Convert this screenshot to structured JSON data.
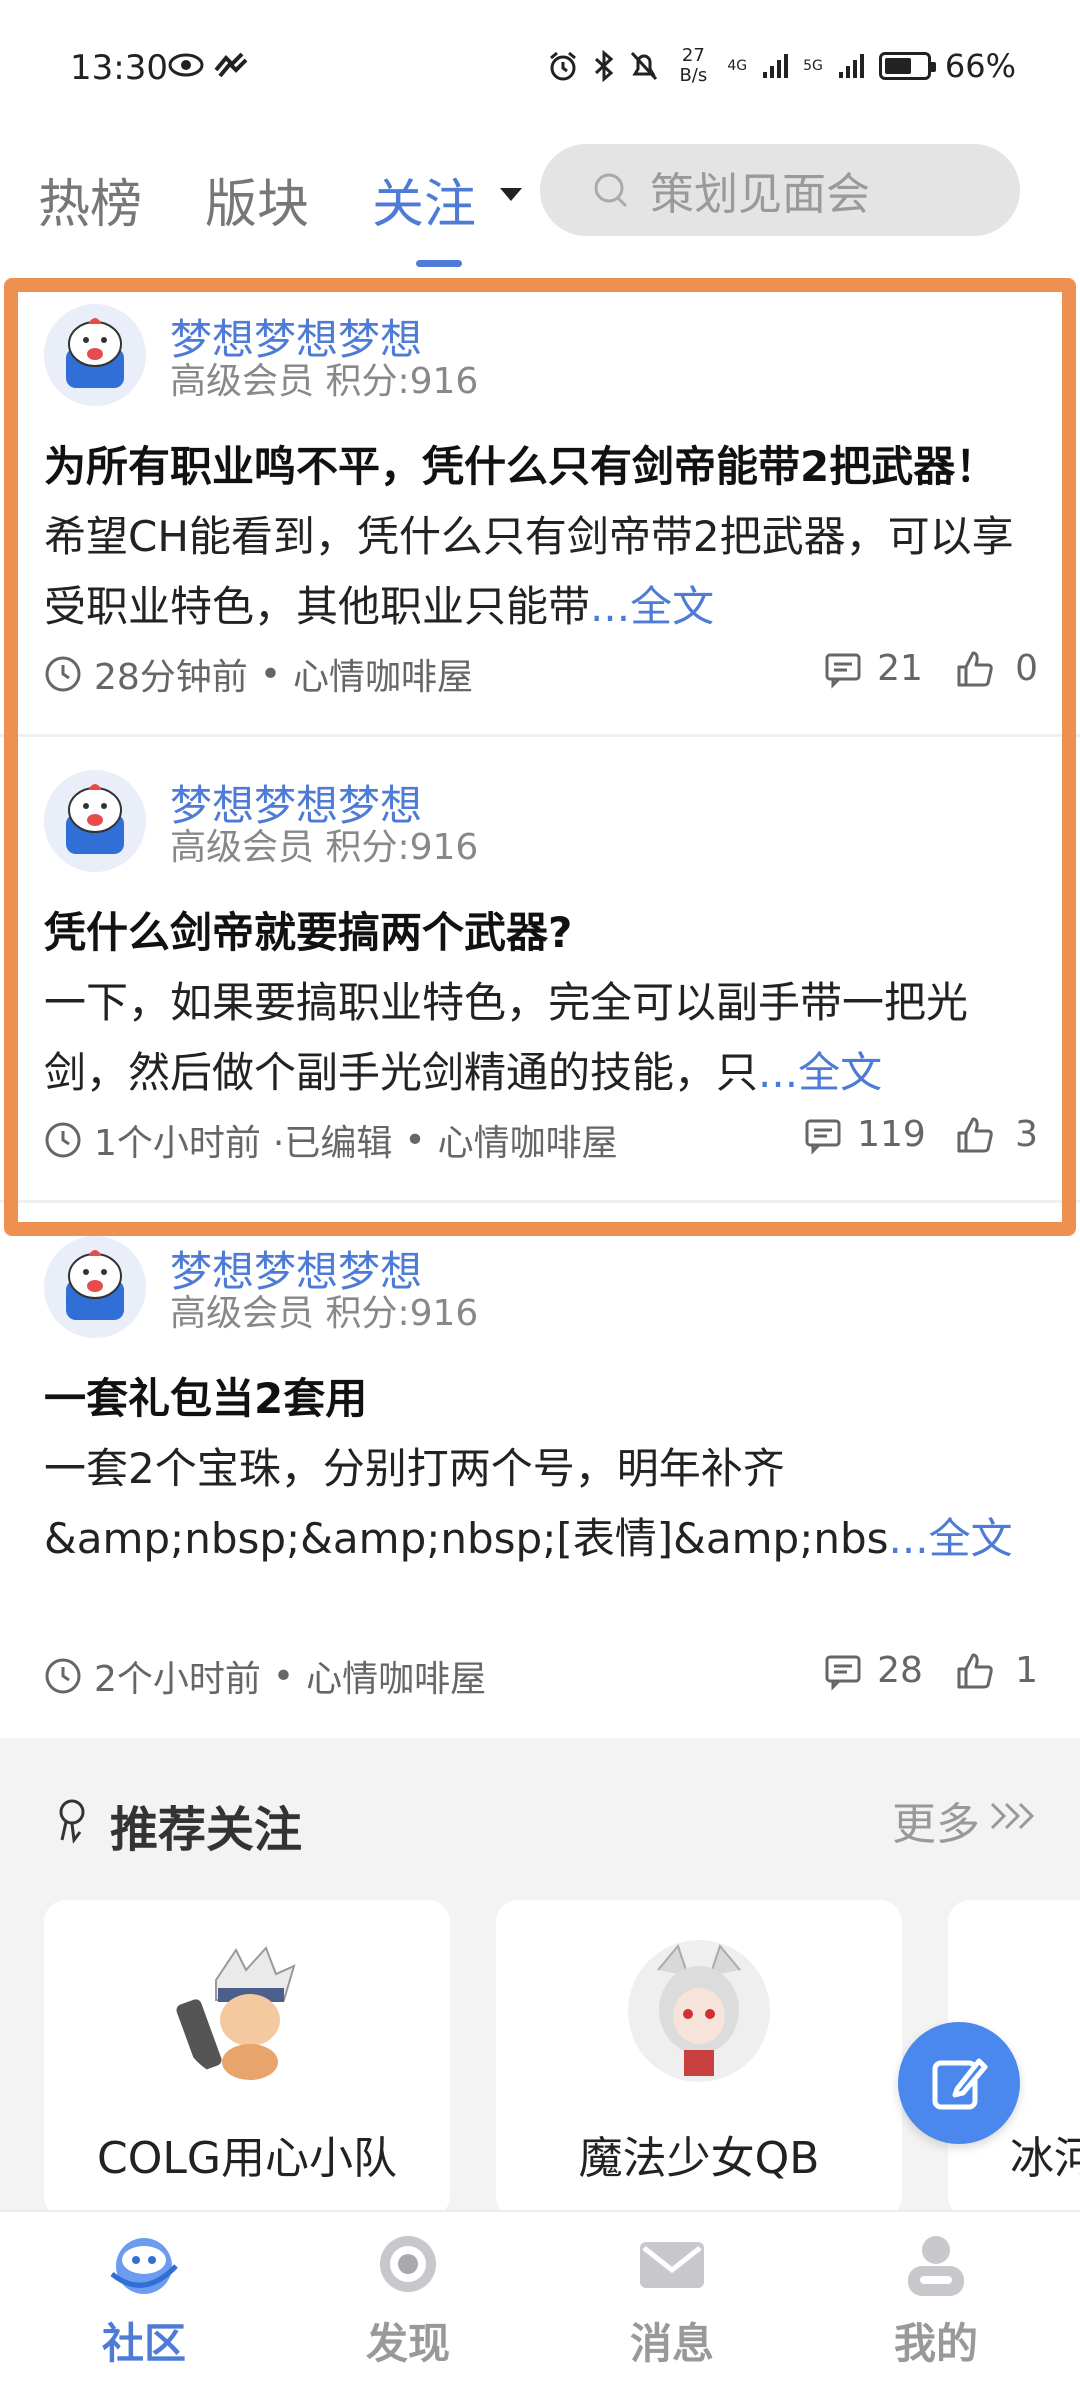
{
  "status_bar": {
    "time": "13:30",
    "net_speed_value": "27",
    "net_speed_unit": "B/s",
    "signal1_label": "4G",
    "signal2_label": "5G",
    "battery": "66%",
    "battery_level": 0.66
  },
  "top_nav": {
    "tabs": [
      {
        "label": "热榜"
      },
      {
        "label": "版块"
      },
      {
        "label": "关注"
      }
    ],
    "active_tab": "关注",
    "search_placeholder": "策划见面会"
  },
  "posts": [
    {
      "username": "梦想梦想梦想",
      "usermeta": "高级会员 积分:916",
      "title": "为所有职业鸣不平，凭什么只有剑帝能带2把武器！",
      "excerpt": "　　希望CH能看到，凭什么只有剑帝带2把武器，可以享受职业特色，其他职业只能带",
      "more": "...全文",
      "time": "28分钟前",
      "edited": "",
      "board": "心情咖啡屋",
      "comments": "21",
      "likes": "0"
    },
    {
      "username": "梦想梦想梦想",
      "usermeta": "高级会员 积分:916",
      "title": "凭什么剑帝就要搞两个武器?",
      "excerpt": "一下，如果要搞职业特色，完全可以副手带一把光剑，然后做个副手光剑精通的技能，只",
      "more": "...全文",
      "time": "1个小时前",
      "edited": "·已编辑",
      "board": "心情咖啡屋",
      "comments": "119",
      "likes": "3"
    },
    {
      "username": "梦想梦想梦想",
      "usermeta": "高级会员 积分:916",
      "title": "一套礼包当2套用",
      "excerpt": "一套2个宝珠，分别打两个号，明年补齐&amp;nbsp;&amp;nbsp;[表情]&amp;nbs",
      "more": "...全文",
      "time": "2个小时前",
      "edited": "",
      "board": "心情咖啡屋",
      "comments": "28",
      "likes": "1"
    }
  ],
  "foot_separator": "•",
  "recommend": {
    "title": "推荐关注",
    "more": "更多",
    "users": [
      {
        "name": "COLG用心小队"
      },
      {
        "name": "魔法少女QB"
      },
      {
        "name": "冰河"
      }
    ]
  },
  "bottom_nav": {
    "items": [
      {
        "label": "社区"
      },
      {
        "label": "发现"
      },
      {
        "label": "消息"
      },
      {
        "label": "我的"
      }
    ],
    "active": "社区"
  },
  "colors": {
    "accent": "#4e7bd6",
    "highlight": "#ee9052",
    "fab": "#4a88ee"
  }
}
